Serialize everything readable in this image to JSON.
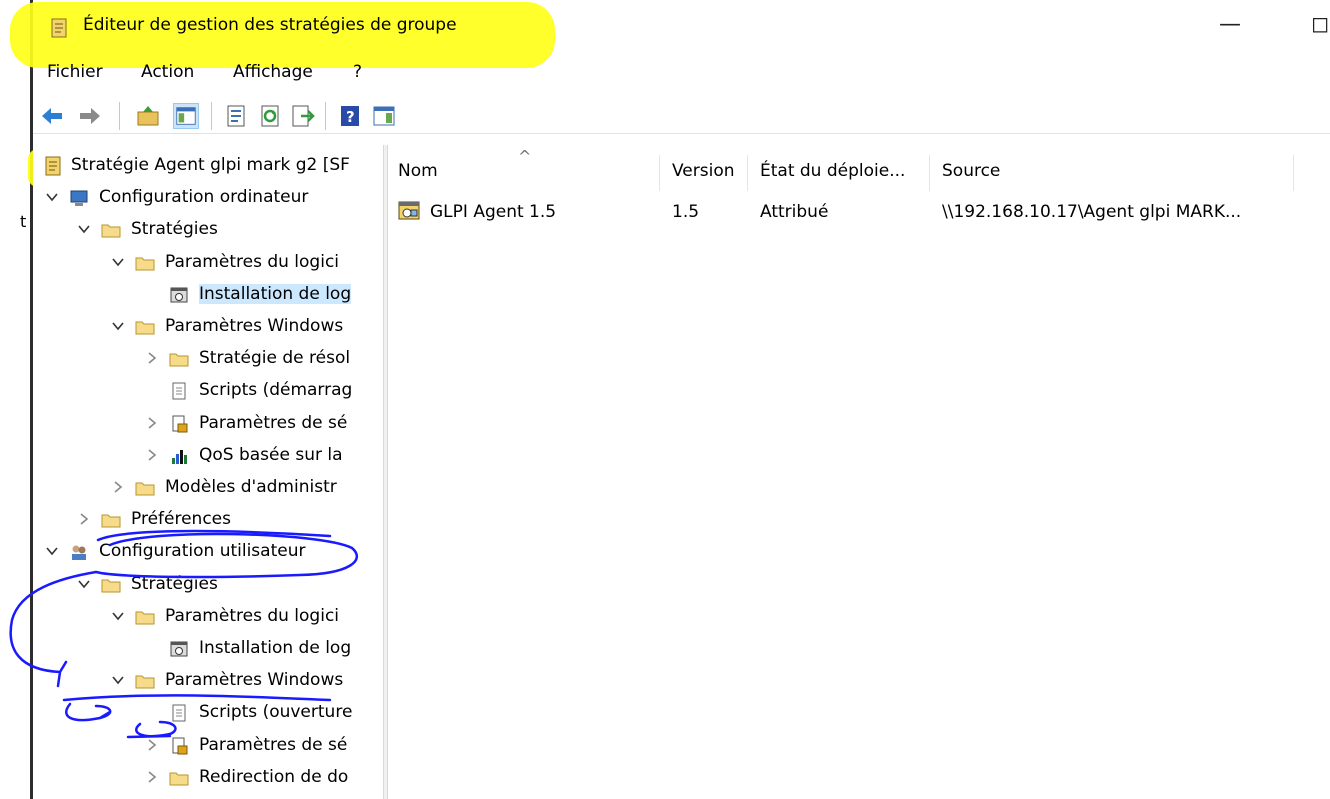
{
  "window": {
    "title": "Éditeur de gestion des stratégies de groupe",
    "minimize_glyph": "—",
    "maximize_glyph": "◻",
    "edge_char": "t"
  },
  "menu": {
    "items": [
      "Fichier",
      "Action",
      "Affichage",
      "?"
    ]
  },
  "toolbar": {
    "buttons": [
      "back-arrow-icon",
      "forward-arrow-icon",
      "up-folder-icon",
      "show-hide-tree-icon",
      "properties-icon",
      "refresh-icon",
      "export-list-icon",
      "help-icon",
      "show-hide-action-pane-icon"
    ]
  },
  "tree": {
    "root": "Stratégie Agent glpi mark g2 [SF",
    "items": [
      {
        "label": "Configuration ordinateur",
        "level": 1,
        "expanded": true
      },
      {
        "label": "Stratégies",
        "level": 2,
        "expanded": true
      },
      {
        "label": "Paramètres du logici",
        "level": 3,
        "expanded": true
      },
      {
        "label": "Installation de log",
        "level": 4,
        "selected": true
      },
      {
        "label": "Paramètres Windows",
        "level": 3,
        "expanded": true
      },
      {
        "label": "Stratégie de résol",
        "level": 4,
        "expanded": false
      },
      {
        "label": "Scripts (démarrag",
        "level": 4
      },
      {
        "label": "Paramètres de sé",
        "level": 4,
        "expanded": false
      },
      {
        "label": "QoS basée sur la",
        "level": 4,
        "expanded": false
      },
      {
        "label": "Modèles d'administr",
        "level": 3,
        "expanded": false
      },
      {
        "label": "Préférences",
        "level": 2,
        "expanded": false
      },
      {
        "label": "Configuration utilisateur",
        "level": 1,
        "expanded": true
      },
      {
        "label": "Stratégies",
        "level": 2,
        "expanded": true
      },
      {
        "label": "Paramètres du logici",
        "level": 3,
        "expanded": true
      },
      {
        "label": "Installation de log",
        "level": 4
      },
      {
        "label": "Paramètres Windows",
        "level": 3,
        "expanded": true
      },
      {
        "label": "Scripts (ouverture",
        "level": 4
      },
      {
        "label": "Paramètres de sé",
        "level": 4,
        "expanded": false
      },
      {
        "label": "Redirection de do",
        "level": 4,
        "expanded": false
      }
    ]
  },
  "list": {
    "columns": [
      "Nom",
      "Version",
      "État du déploie...",
      "Source"
    ],
    "sort_arrow": "^",
    "rows": [
      {
        "name": "GLPI Agent 1.5",
        "version": "1.5",
        "state": "Attribué",
        "source": "\\\\192.168.10.17\\Agent glpi MARK..."
      }
    ]
  },
  "colors": {
    "highlight": "#ffff1a",
    "ink": "#1a1aff",
    "selection": "#cce8ff"
  }
}
